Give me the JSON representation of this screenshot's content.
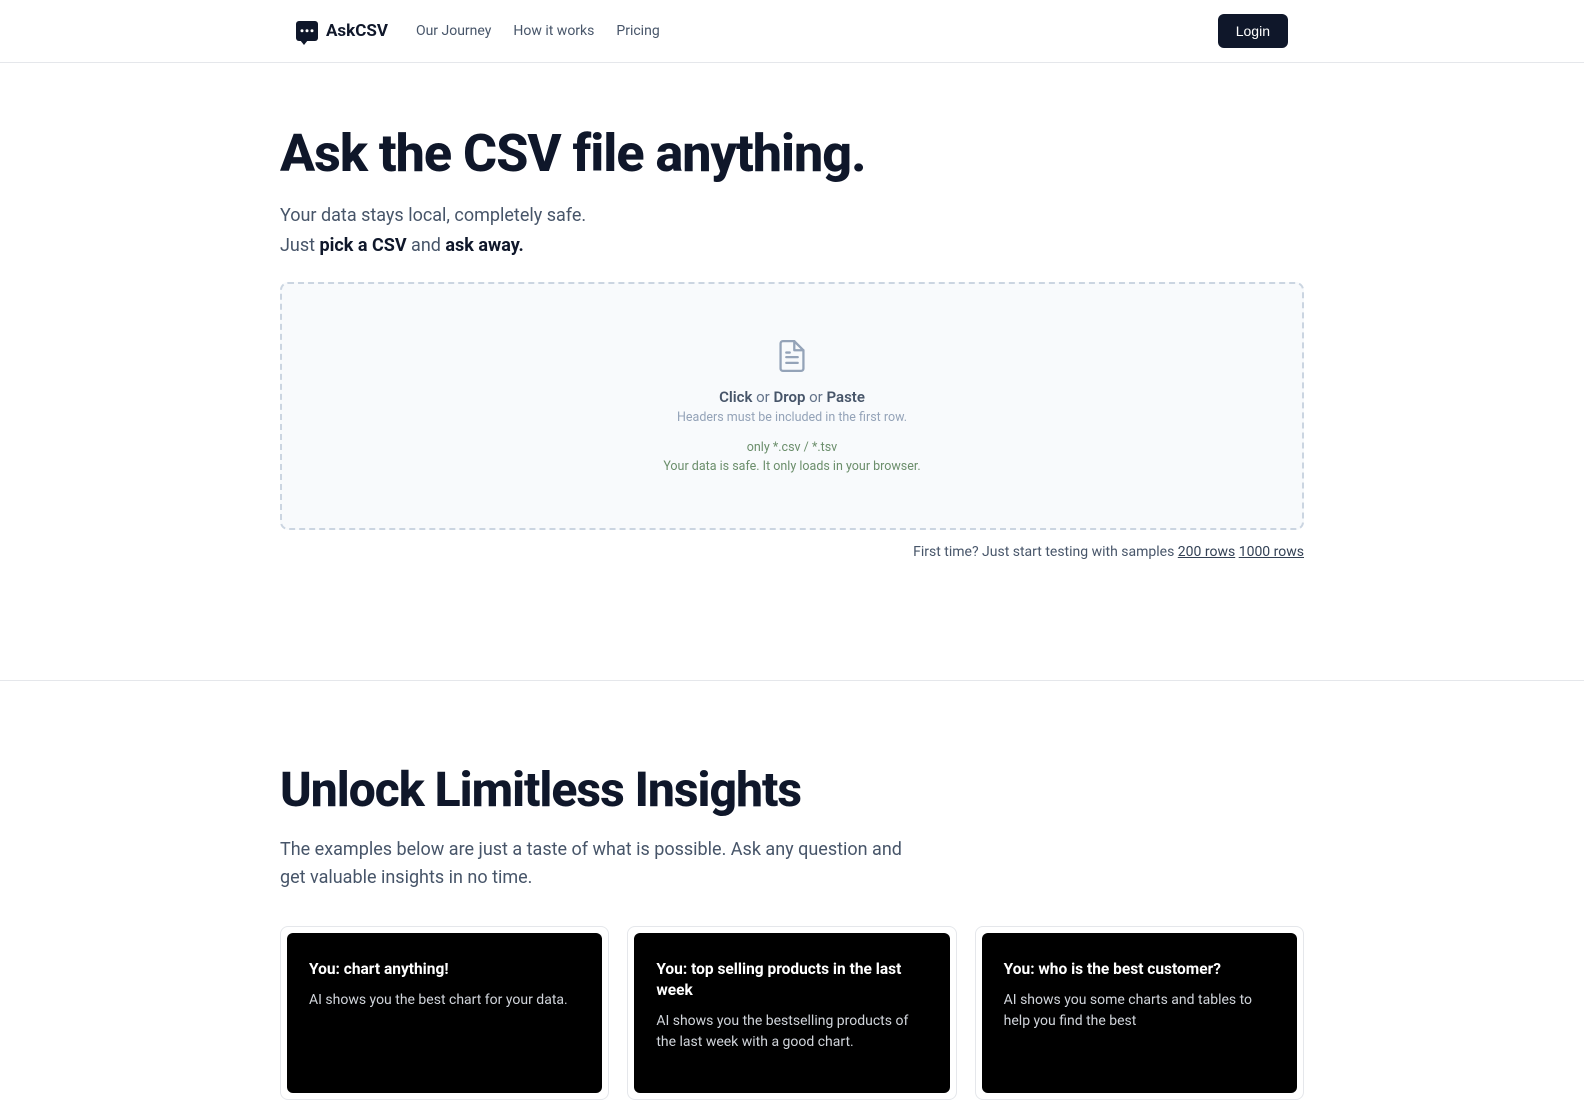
{
  "header": {
    "brand": "AskCSV",
    "nav": {
      "journey": "Our Journey",
      "how": "How it works",
      "pricing": "Pricing"
    },
    "login": "Login"
  },
  "hero": {
    "title": "Ask the CSV file anything.",
    "subtitle_line1": "Your data stays local, completely safe.",
    "subtitle_just": "Just ",
    "subtitle_pick": "pick a CSV",
    "subtitle_and": " and ",
    "subtitle_ask": "ask away."
  },
  "dropzone": {
    "click": "Click",
    "or1": " or ",
    "drop": "Drop",
    "or2": " or ",
    "paste": "Paste",
    "headers_note": "Headers must be included in the first row.",
    "file_types": "only *.csv / *.tsv",
    "safety": "Your data is safe. It only loads in your browser."
  },
  "samples": {
    "prefix": "First time? Just start testing with samples ",
    "link1": "200 rows",
    "sep": " ",
    "link2": "1000 rows"
  },
  "insights": {
    "title": "Unlock Limitless Insights",
    "subtitle": "The examples below are just a taste of what is possible. Ask any question and get valuable insights in no time."
  },
  "cards": [
    {
      "title": "You: chart anything!",
      "desc": "AI shows you the best chart for your data."
    },
    {
      "title": "You: top selling products in the last week",
      "desc": "AI shows you the bestselling products of the last week with a good chart."
    },
    {
      "title": "You: who is the best customer?",
      "desc": "AI shows you some charts and tables to help you find the best"
    }
  ]
}
